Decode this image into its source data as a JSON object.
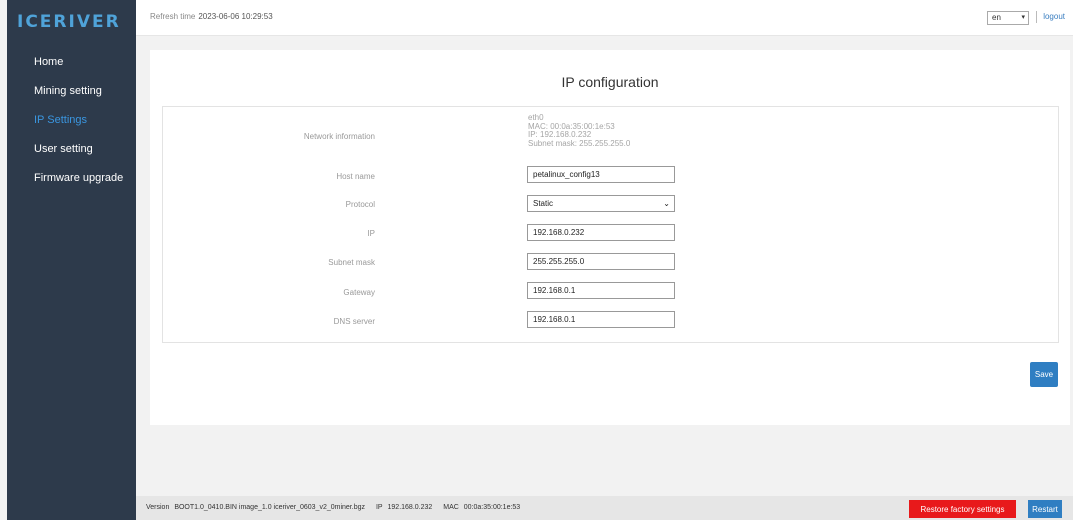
{
  "brand": {
    "logo_text": "ICERIVER"
  },
  "sidebar": {
    "items": [
      {
        "label": "Home",
        "active": false
      },
      {
        "label": "Mining setting",
        "active": false
      },
      {
        "label": "IP Settings",
        "active": true
      },
      {
        "label": "User setting",
        "active": false
      },
      {
        "label": "Firmware upgrade",
        "active": false
      }
    ]
  },
  "topbar": {
    "refresh_label": "Refresh time",
    "refresh_value": "2023-06-06 10:29:53",
    "language": "en",
    "logout_label": "logout"
  },
  "page": {
    "title": "IP configuration"
  },
  "form": {
    "network_info_label": "Network information",
    "network_info": {
      "interface": "eth0",
      "mac": "MAC: 00:0a:35:00:1e:53",
      "ip": "IP: 192.168.0.232",
      "subnet": "Subnet mask: 255.255.255.0"
    },
    "host_name_label": "Host name",
    "host_name_value": "petalinux_config13",
    "protocol_label": "Protocol",
    "protocol_value": "Static",
    "ip_label": "IP",
    "ip_value": "192.168.0.232",
    "subnet_label": "Subnet mask",
    "subnet_value": "255.255.255.0",
    "gateway_label": "Gateway",
    "gateway_value": "192.168.0.1",
    "dns_label": "DNS server",
    "dns_value": "192.168.0.1",
    "save_label": "Save"
  },
  "footer": {
    "version_label": "Version",
    "version_value": "BOOT1.0_0410.BIN image_1.0 iceriver_0603_v2_0miner.bgz",
    "ip_label": "IP",
    "ip_value": "192.168.0.232",
    "mac_label": "MAC",
    "mac_value": "00:0a:35:00:1e:53",
    "restore_label": "Restore factory settings",
    "restart_label": "Restart"
  },
  "colors": {
    "sidebar_bg": "#2d3a4b",
    "accent": "#2f7ec2",
    "active_nav": "#3a96e0",
    "danger": "#e8191b"
  }
}
